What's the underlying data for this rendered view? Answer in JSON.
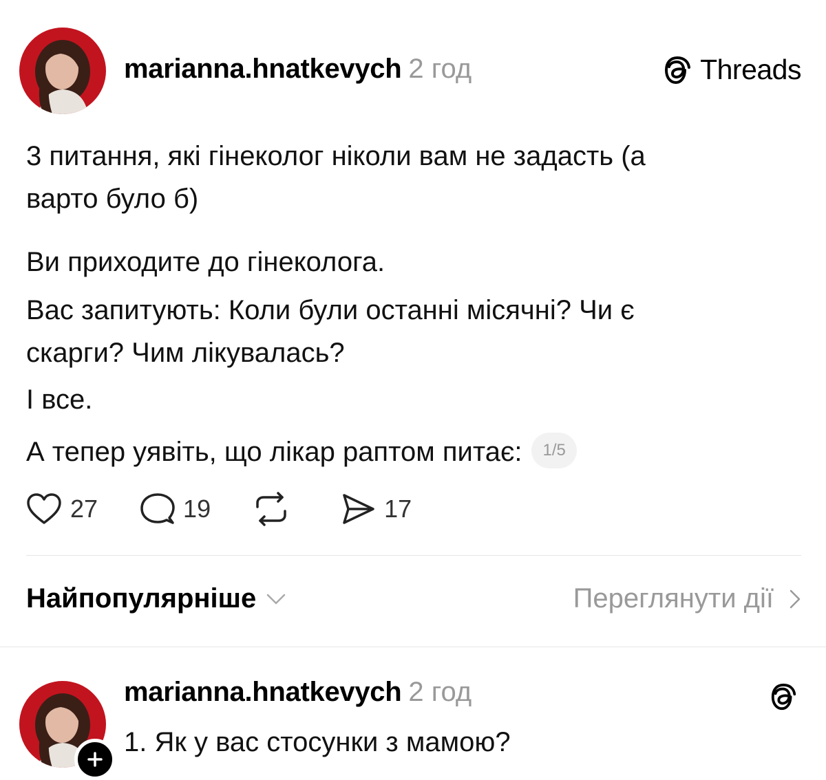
{
  "post": {
    "username": "marianna.hnatkevych",
    "time": "2 год",
    "brand": "Threads",
    "lines": [
      "3 питання, які гінеколог ніколи вам не задасть (а",
      "варто було б)",
      "Ви приходите до гінеколога.",
      "Вас запитують: Коли були останні місячні? Чи є",
      "скарги? Чим лікувалась?",
      "І все.",
      "А тепер уявіть, що лікар раптом питає:"
    ],
    "pager": "1/5",
    "likes": "27",
    "comments": "19",
    "shares": "17"
  },
  "sort": {
    "label": "Найпопулярніше",
    "view_activity": "Переглянути дії"
  },
  "reply": {
    "username": "marianna.hnatkevych",
    "time": "2 год",
    "text": "1. Як у вас стосунки з мамою?"
  },
  "colors": {
    "avatar_bg": "#c2141f",
    "muted": "#999999",
    "divider": "#e6e6e6"
  }
}
